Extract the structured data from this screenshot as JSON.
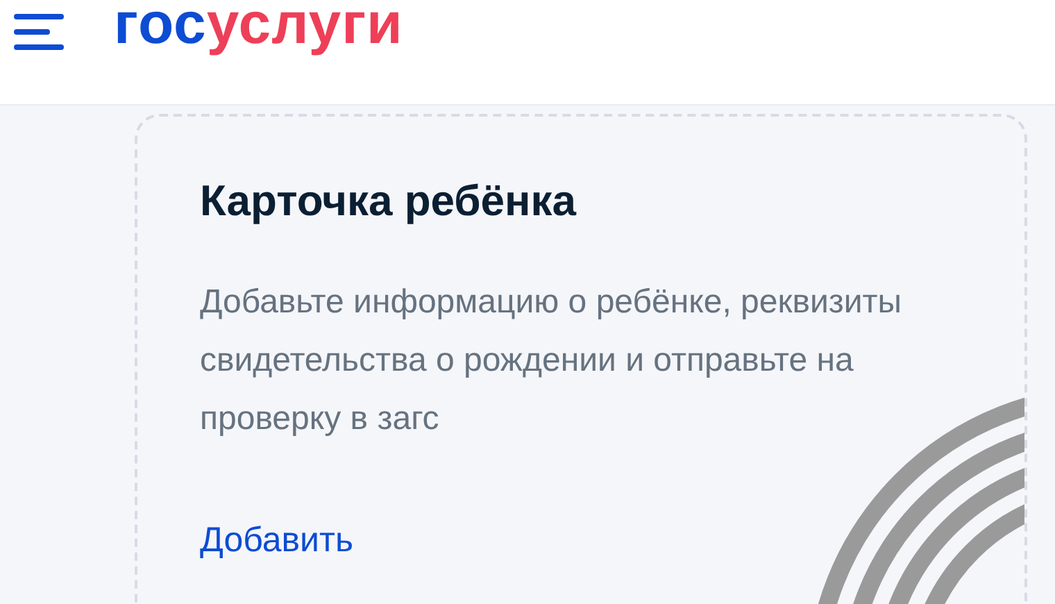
{
  "header": {
    "logo": [
      {
        "text": "гос",
        "color": "#0d4cd3"
      },
      {
        "text": "услуги",
        "color": "#ee3f58"
      }
    ]
  },
  "card": {
    "title": "Карточка ребёнка",
    "description": "Добавьте информацию о ребёнке, реквизиты свидетельства о рождении и отправьте на проверку в загс",
    "link": "Добавить"
  }
}
